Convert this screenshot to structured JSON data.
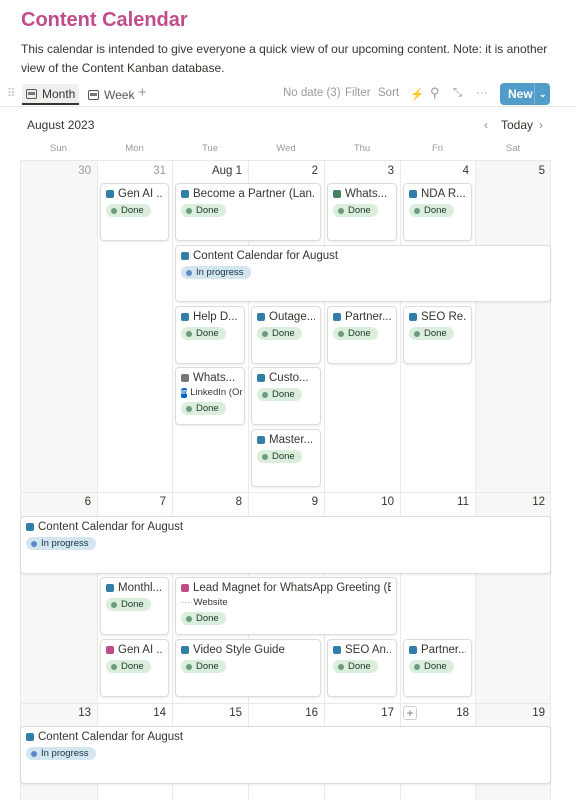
{
  "page": {
    "title": "Content Calendar",
    "description": "This calendar is intended to give everyone a quick view of our upcoming content. Note: it is another view of the Content Kanban database."
  },
  "toolbar": {
    "tabs": [
      {
        "label": "Month",
        "active": true
      },
      {
        "label": "Week",
        "active": false
      }
    ],
    "add": "+",
    "no_date": "No date (3)",
    "filter": "Filter",
    "sort": "Sort",
    "bolt": "⚡",
    "search": "⚲",
    "expand": "⤡",
    "more": "···",
    "new_label": "New",
    "new_caret": "⌄"
  },
  "calendar": {
    "month": "August 2023",
    "prev": "‹",
    "today": "Today",
    "next": "›",
    "weekdays": [
      "Sun",
      "Mon",
      "Tue",
      "Wed",
      "Thu",
      "Fri",
      "Sat"
    ],
    "weeks": [
      [
        "30",
        "31",
        "Aug 1",
        "2",
        "3",
        "4",
        "5"
      ],
      [
        "6",
        "7",
        "8",
        "9",
        "10",
        "11",
        "12"
      ],
      [
        "13",
        "14",
        "15",
        "16",
        "17",
        "18",
        "19"
      ]
    ],
    "add_button": "+"
  },
  "colors": {
    "title": "#c14c8a",
    "accent": "#529cca",
    "done_bg": "#dbeddb",
    "in_progress_bg": "#d3e5ef"
  },
  "cards": [
    {
      "title": "Gen AI ...",
      "status": "Done",
      "icon": "robot-icon",
      "color": "#337ea9"
    },
    {
      "title": "Become a Partner (Lan...",
      "status": "Done",
      "icon": "people-icon",
      "color": "#337ea9"
    },
    {
      "title": "Whats...",
      "status": "Done",
      "icon": "phone-icon",
      "color": "#448361"
    },
    {
      "title": "NDA R...",
      "status": "Done",
      "icon": "send-icon",
      "color": "#337ea9"
    },
    {
      "title": "Content Calendar for August",
      "status": "In progress",
      "icon": "calendar-icon",
      "color": "#337ea9"
    },
    {
      "title": "Help D...",
      "status": "Done",
      "icon": "help-icon",
      "color": "#337ea9"
    },
    {
      "title": "Outage...",
      "status": "Done",
      "icon": "plug-icon",
      "color": "#337ea9"
    },
    {
      "title": "Partner...",
      "status": "Done",
      "icon": "question-icon",
      "color": "#337ea9"
    },
    {
      "title": "SEO Re...",
      "status": "Done",
      "icon": "question-icon",
      "color": "#337ea9"
    },
    {
      "title": "Whats...",
      "status": "Done",
      "icon": "message-icon",
      "color": "#787774",
      "extra": "LinkedIn (Or"
    },
    {
      "title": "Custo...",
      "status": "Done",
      "icon": "bell-icon",
      "color": "#337ea9"
    },
    {
      "title": "Master...",
      "status": "Done",
      "icon": "card-icon",
      "color": "#337ea9"
    },
    {
      "title": "Content Calendar for August",
      "status": "In progress",
      "icon": "calendar-icon",
      "color": "#337ea9"
    },
    {
      "title": "Monthl...",
      "status": "Done",
      "icon": "newsletter-icon",
      "color": "#337ea9"
    },
    {
      "title": "Lead Magnet for WhatsApp Greeting (Ebook)",
      "status": "Done",
      "icon": "magnet-icon",
      "color": "#c14c8a",
      "extra": "Website"
    },
    {
      "title": "Gen AI ...",
      "status": "Done",
      "icon": "robot-icon",
      "color": "#c14c8a"
    },
    {
      "title": "Video Style Guide",
      "status": "Done",
      "icon": "video-icon",
      "color": "#337ea9"
    },
    {
      "title": "SEO An...",
      "status": "Done",
      "icon": "search-icon",
      "color": "#337ea9"
    },
    {
      "title": "Partner...",
      "status": "Done",
      "icon": "people-icon",
      "color": "#337ea9"
    },
    {
      "title": "Content Calendar for August",
      "status": "In progress",
      "icon": "calendar-icon",
      "color": "#337ea9"
    }
  ]
}
